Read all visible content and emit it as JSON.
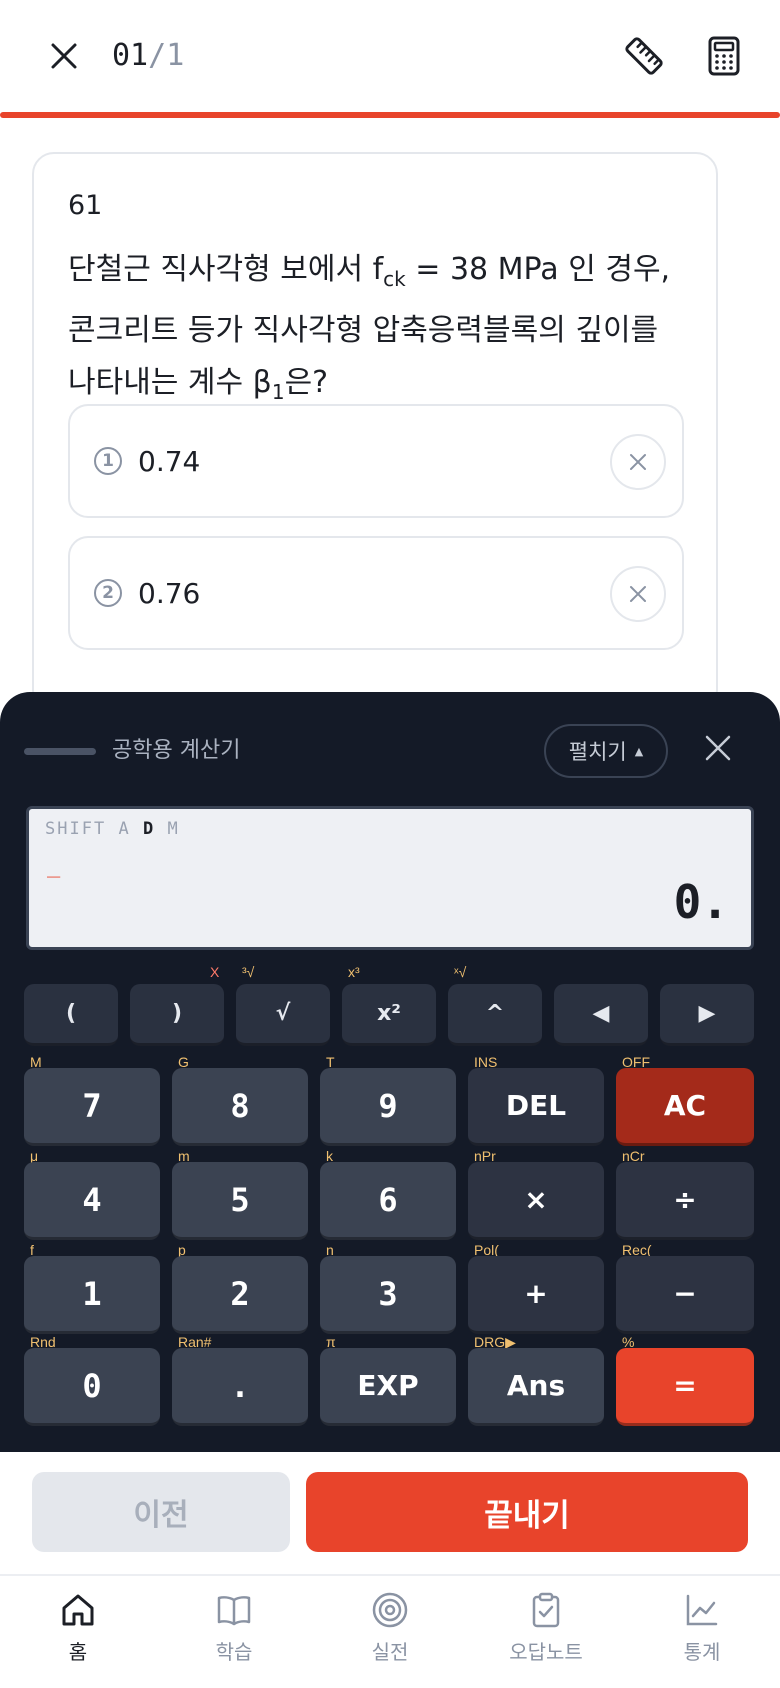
{
  "header": {
    "counter_current": "01",
    "counter_sep": "/",
    "counter_total": "1"
  },
  "question": {
    "number": "61",
    "line1_pre": "단철근 직사각형 보에서 f",
    "line1_sub": "ck",
    "line1_post": " = 38 MPa 인 경우,",
    "line2": "콘크리트 등가 직사각형 압축응력블록의 깊이를",
    "line3_pre": "나타내는 계수 β",
    "line3_sub": "1",
    "line3_post": "은?",
    "options": [
      {
        "marker": "1",
        "value": "0.74"
      },
      {
        "marker": "2",
        "value": "0.76"
      }
    ]
  },
  "calculator": {
    "title": "공학용 계산기",
    "expand_label": "펼치기",
    "expand_arrow": "▲",
    "display": {
      "flag_shift": "SHIFT",
      "flag_a": "A",
      "flag_d": "D",
      "flag_m": "M",
      "cursor": "_",
      "result": "0."
    },
    "row1": [
      {
        "label": "(",
        "sub": ""
      },
      {
        "label": ")",
        "sub": "X"
      },
      {
        "label": "√",
        "sub": "³√"
      },
      {
        "label": "x²",
        "sub": "x³"
      },
      {
        "label": "^",
        "sub": "ˣ√"
      },
      {
        "label": "◀",
        "sub": ""
      },
      {
        "label": "▶",
        "sub": ""
      }
    ],
    "rows": [
      [
        {
          "label": "7",
          "sub": "M",
          "kind": "num"
        },
        {
          "label": "8",
          "sub": "G",
          "kind": "num"
        },
        {
          "label": "9",
          "sub": "T",
          "kind": "num"
        },
        {
          "label": "DEL",
          "sub": "INS",
          "kind": "func"
        },
        {
          "label": "AC",
          "sub": "OFF",
          "kind": "ac"
        }
      ],
      [
        {
          "label": "4",
          "sub": "μ",
          "kind": "num"
        },
        {
          "label": "5",
          "sub": "m",
          "kind": "num"
        },
        {
          "label": "6",
          "sub": "k",
          "kind": "num"
        },
        {
          "label": "×",
          "sub": "nPr",
          "kind": "func"
        },
        {
          "label": "÷",
          "sub": "nCr",
          "kind": "func"
        }
      ],
      [
        {
          "label": "1",
          "sub": "f",
          "kind": "num"
        },
        {
          "label": "2",
          "sub": "p",
          "kind": "num"
        },
        {
          "label": "3",
          "sub": "n",
          "kind": "num"
        },
        {
          "label": "+",
          "sub": "Pol(",
          "kind": "func"
        },
        {
          "label": "−",
          "sub": "Rec(",
          "kind": "func"
        }
      ],
      [
        {
          "label": "0",
          "sub": "Rnd",
          "kind": "num"
        },
        {
          "label": ".",
          "sub": "Ran#",
          "kind": "num"
        },
        {
          "label": "EXP",
          "sub": "π",
          "kind": "func2"
        },
        {
          "label": "Ans",
          "sub": "DRG▶",
          "kind": "func2"
        },
        {
          "label": "=",
          "sub": "%",
          "kind": "eq"
        }
      ]
    ]
  },
  "actions": {
    "prev_label": "이전",
    "finish_label": "끝내기"
  },
  "nav": {
    "items": [
      {
        "label": "홈",
        "icon": "home-icon"
      },
      {
        "label": "학습",
        "icon": "book-icon"
      },
      {
        "label": "실전",
        "icon": "target-icon"
      },
      {
        "label": "오답노트",
        "icon": "clipboard-check-icon"
      },
      {
        "label": "통계",
        "icon": "chart-line-icon"
      }
    ]
  },
  "colors": {
    "accent": "#e8442b",
    "calc_bg": "#141a27",
    "ac_key": "#a42a1a"
  }
}
